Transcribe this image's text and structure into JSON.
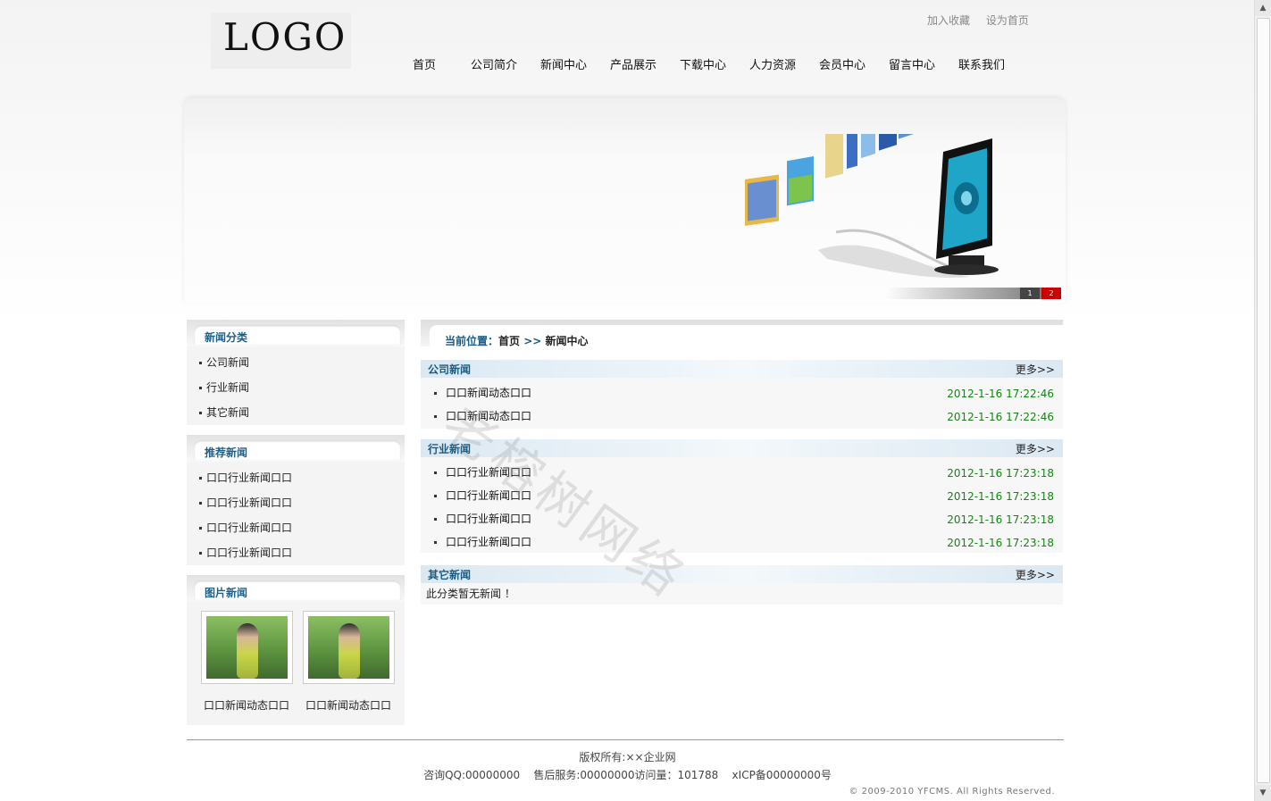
{
  "header": {
    "logo_text": "LOGO",
    "top_links": [
      "加入收藏",
      "设为首页"
    ],
    "nav": [
      "首页",
      "公司简介",
      "新闻中心",
      "产品展示",
      "下载中心",
      "人力资源",
      "会员中心",
      "留言中心",
      "联系我们"
    ]
  },
  "banner": {
    "slides": [
      "1",
      "2"
    ],
    "active_slide": "2"
  },
  "sidebar": {
    "categories": {
      "title": "新闻分类",
      "items": [
        "公司新闻",
        "行业新闻",
        "其它新闻"
      ]
    },
    "recommended": {
      "title": "推荐新闻",
      "items": [
        "口口行业新闻口口",
        "口口行业新闻口口",
        "口口行业新闻口口",
        "口口行业新闻口口"
      ]
    },
    "photo_news": {
      "title": "图片新闻",
      "items": [
        {
          "caption": "口口新闻动态口口"
        },
        {
          "caption": "口口新闻动态口口"
        }
      ]
    }
  },
  "main": {
    "breadcrumb": {
      "label": "当前位置：",
      "home": "首页",
      "sep": ">>",
      "current": "新闻中心"
    },
    "sections": [
      {
        "title": "公司新闻",
        "more": "更多>>",
        "items": [
          {
            "title": "口口新闻动态口口",
            "date": "2012-1-16 17:22:46"
          },
          {
            "title": "口口新闻动态口口",
            "date": "2012-1-16 17:22:46"
          }
        ]
      },
      {
        "title": "行业新闻",
        "more": "更多>>",
        "items": [
          {
            "title": "口口行业新闻口口",
            "date": "2012-1-16 17:23:18"
          },
          {
            "title": "口口行业新闻口口",
            "date": "2012-1-16 17:23:18"
          },
          {
            "title": "口口行业新闻口口",
            "date": "2012-1-16 17:23:18"
          },
          {
            "title": "口口行业新闻口口",
            "date": "2012-1-16 17:23:18"
          }
        ]
      },
      {
        "title": "其它新闻",
        "more": "更多>>",
        "empty_text": "此分类暂无新闻 ！"
      }
    ]
  },
  "footer": {
    "copyright": "版权所有:××企业网",
    "contact": "咨询QQ:00000000    售后服务:00000000访问量：101788    xICP备00000000号",
    "rights": "© 2009-2010 YFCMS. All Rights Reserved."
  },
  "watermark": "老榕树网络",
  "colors": {
    "heading_blue": "#1a5a83",
    "date_green": "#118811",
    "active_slide_red": "#cc0000"
  }
}
